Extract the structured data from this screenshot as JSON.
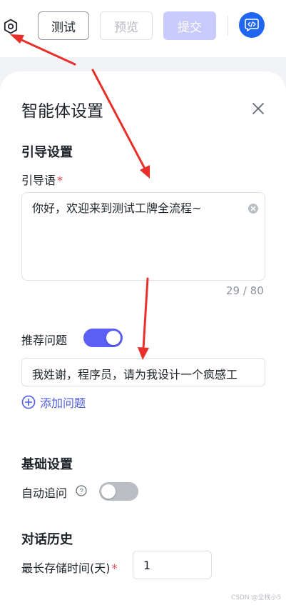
{
  "toolbar": {
    "settings_icon": "gear-icon",
    "test_label": "测试",
    "preview_label": "预览",
    "submit_label": "提交",
    "api_icon": "code-icon"
  },
  "panel": {
    "title": "智能体设置",
    "close_icon": "close-icon",
    "guide_section": {
      "heading": "引导设置",
      "greeting_label": "引导语",
      "required_mark": "*",
      "greeting_value": "你好，欢迎来到测试工牌全流程~",
      "counter": "29 / 80",
      "recommend_label": "推荐问题",
      "recommend_enabled": true,
      "question_value": "我姓谢，程序员，请为我设计一个疯感工",
      "add_question_label": "添加问题"
    },
    "basic_section": {
      "heading": "基础设置",
      "auto_followup_label": "自动追问",
      "auto_followup_enabled": false
    },
    "history_section": {
      "heading": "对话历史",
      "max_storage_label": "最长存储时间(天)",
      "required_mark": "*",
      "max_storage_value": "1"
    }
  },
  "watermark": "CSDN @全栈小5",
  "colors": {
    "accent": "#5b5ff5",
    "link": "#4e5be6",
    "required": "#e5484d",
    "submit_disabled": "#c8cbfb",
    "api_badge": "#1f66f0",
    "annotation_arrow": "#e8302a"
  }
}
